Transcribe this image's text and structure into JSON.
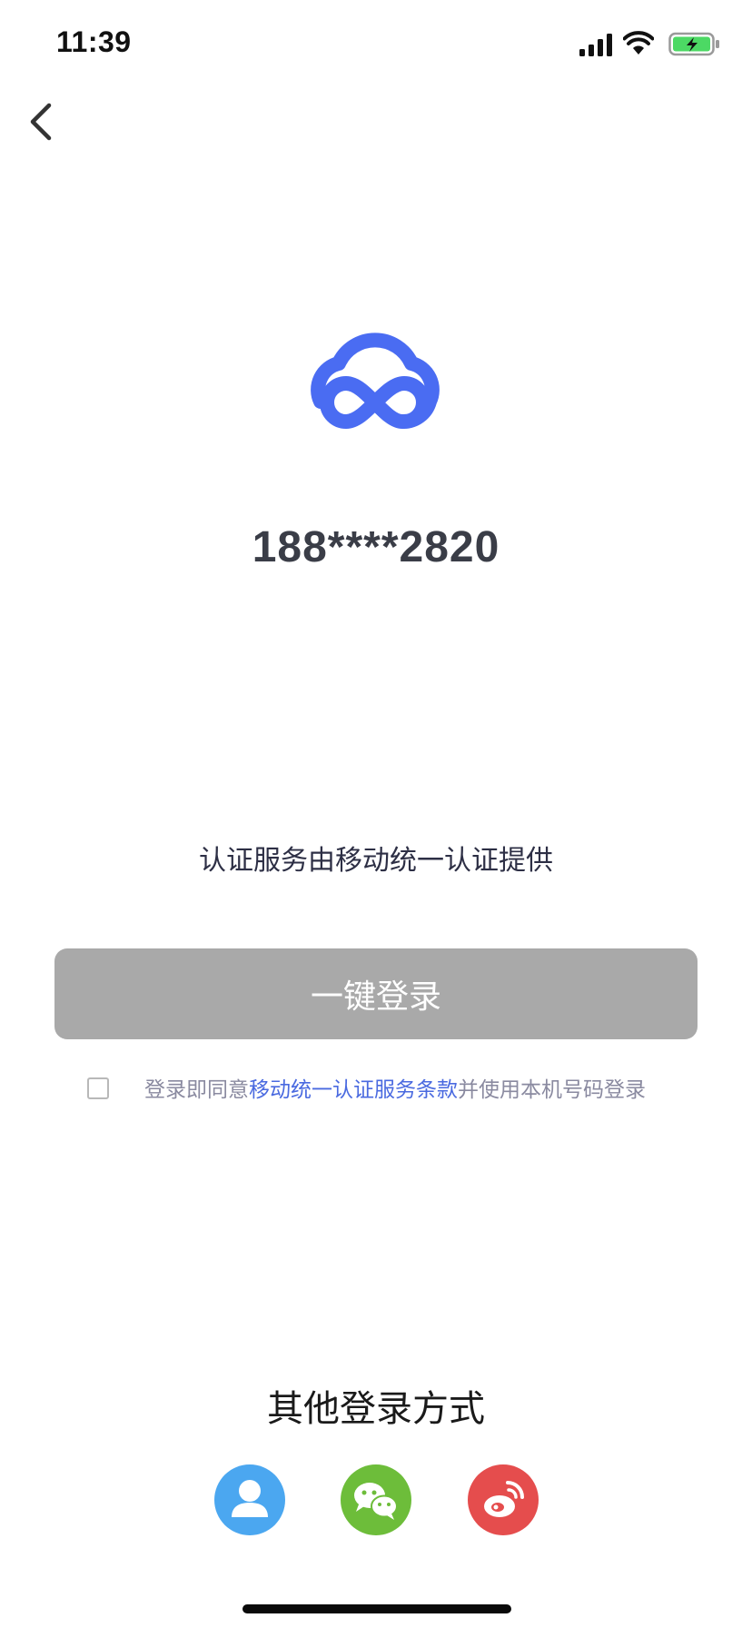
{
  "status_bar": {
    "time": "11:39",
    "icons": [
      "cellular-signal-icon",
      "wifi-icon",
      "battery-charging-icon"
    ],
    "battery_color": "#4cd964"
  },
  "navigation": {
    "back_icon": "chevron-left-icon"
  },
  "logo": {
    "icon": "cloud-infinity-logo",
    "color": "#4a6cf2"
  },
  "phone": {
    "masked_number": "188****2820"
  },
  "service": {
    "note": "认证服务由移动统一认证提供"
  },
  "login": {
    "button_label": "一键登录",
    "button_color": "#a9a9a9"
  },
  "agreement": {
    "checked": false,
    "prefix": "登录即同意",
    "link": "移动统一认证服务条款",
    "suffix": "并使用本机号码登录",
    "link_color": "#4a6ae0"
  },
  "other_login": {
    "title": "其他登录方式",
    "options": [
      {
        "icon": "user-account-icon",
        "color": "#4ba7f0"
      },
      {
        "icon": "wechat-icon",
        "color": "#6dbd3a"
      },
      {
        "icon": "weibo-icon",
        "color": "#e54d4d"
      }
    ]
  }
}
